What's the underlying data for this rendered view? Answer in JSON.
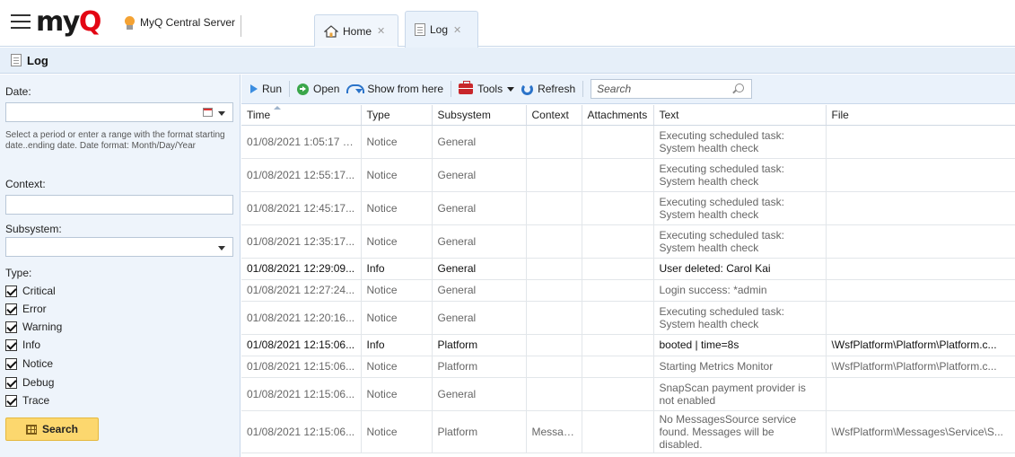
{
  "app": {
    "server_name": "MyQ Central Server"
  },
  "tabs": [
    {
      "label": "Home",
      "close": "✕"
    },
    {
      "label": "Log",
      "close": "✕"
    }
  ],
  "page_title": "Log",
  "filters": {
    "date_label": "Date:",
    "date_value": "",
    "date_hint": "Select a period or enter a range with the format starting date..ending date. Date format: Month/Day/Year",
    "context_label": "Context:",
    "context_value": "",
    "subsystem_label": "Subsystem:",
    "subsystem_value": "",
    "type_label": "Type:",
    "types": [
      {
        "label": "Critical",
        "checked": true
      },
      {
        "label": "Error",
        "checked": true
      },
      {
        "label": "Warning",
        "checked": true
      },
      {
        "label": "Info",
        "checked": true
      },
      {
        "label": "Notice",
        "checked": true
      },
      {
        "label": "Debug",
        "checked": true
      },
      {
        "label": "Trace",
        "checked": true
      }
    ],
    "search_button": "Search"
  },
  "toolbar": {
    "run": "Run",
    "open": "Open",
    "show_from_here": "Show from here",
    "tools": "Tools",
    "refresh": "Refresh",
    "search_placeholder": "Search"
  },
  "table": {
    "columns": [
      "Time",
      "Type",
      "Subsystem",
      "Context",
      "Attachments",
      "Text",
      "File"
    ],
    "rows": [
      {
        "time": "01/08/2021 1:05:17 P...",
        "type": "Notice",
        "subsystem": "General",
        "context": "",
        "attachments": "",
        "text": "Executing scheduled task: System health check",
        "file": ""
      },
      {
        "time": "01/08/2021 12:55:17...",
        "type": "Notice",
        "subsystem": "General",
        "context": "",
        "attachments": "",
        "text": "Executing scheduled task: System health check",
        "file": ""
      },
      {
        "time": "01/08/2021 12:45:17...",
        "type": "Notice",
        "subsystem": "General",
        "context": "",
        "attachments": "",
        "text": "Executing scheduled task: System health check",
        "file": ""
      },
      {
        "time": "01/08/2021 12:35:17...",
        "type": "Notice",
        "subsystem": "General",
        "context": "",
        "attachments": "",
        "text": "Executing scheduled task: System health check",
        "file": ""
      },
      {
        "time": "01/08/2021 12:29:09...",
        "type": "Info",
        "subsystem": "General",
        "context": "",
        "attachments": "",
        "text": "User deleted: Carol Kai",
        "file": ""
      },
      {
        "time": "01/08/2021 12:27:24...",
        "type": "Notice",
        "subsystem": "General",
        "context": "",
        "attachments": "",
        "text": "Login success: *admin",
        "file": ""
      },
      {
        "time": "01/08/2021 12:20:16...",
        "type": "Notice",
        "subsystem": "General",
        "context": "",
        "attachments": "",
        "text": "Executing scheduled task: System health check",
        "file": ""
      },
      {
        "time": "01/08/2021 12:15:06...",
        "type": "Info",
        "subsystem": "Platform",
        "context": "",
        "attachments": "",
        "text": "booted | time=8s",
        "file": "\\WsfPlatform\\Platform\\Platform.c..."
      },
      {
        "time": "01/08/2021 12:15:06...",
        "type": "Notice",
        "subsystem": "Platform",
        "context": "",
        "attachments": "",
        "text": "Starting Metrics Monitor",
        "file": "\\WsfPlatform\\Platform\\Platform.c..."
      },
      {
        "time": "01/08/2021 12:15:06...",
        "type": "Notice",
        "subsystem": "General",
        "context": "",
        "attachments": "",
        "text": "SnapScan payment provider is not enabled",
        "file": ""
      },
      {
        "time": "01/08/2021 12:15:06...",
        "type": "Notice",
        "subsystem": "Platform",
        "context": "Messages",
        "attachments": "",
        "text": "No MessagesSource service found. Messages will be disabled.",
        "file": "\\WsfPlatform\\Messages\\Service\\S..."
      }
    ]
  }
}
